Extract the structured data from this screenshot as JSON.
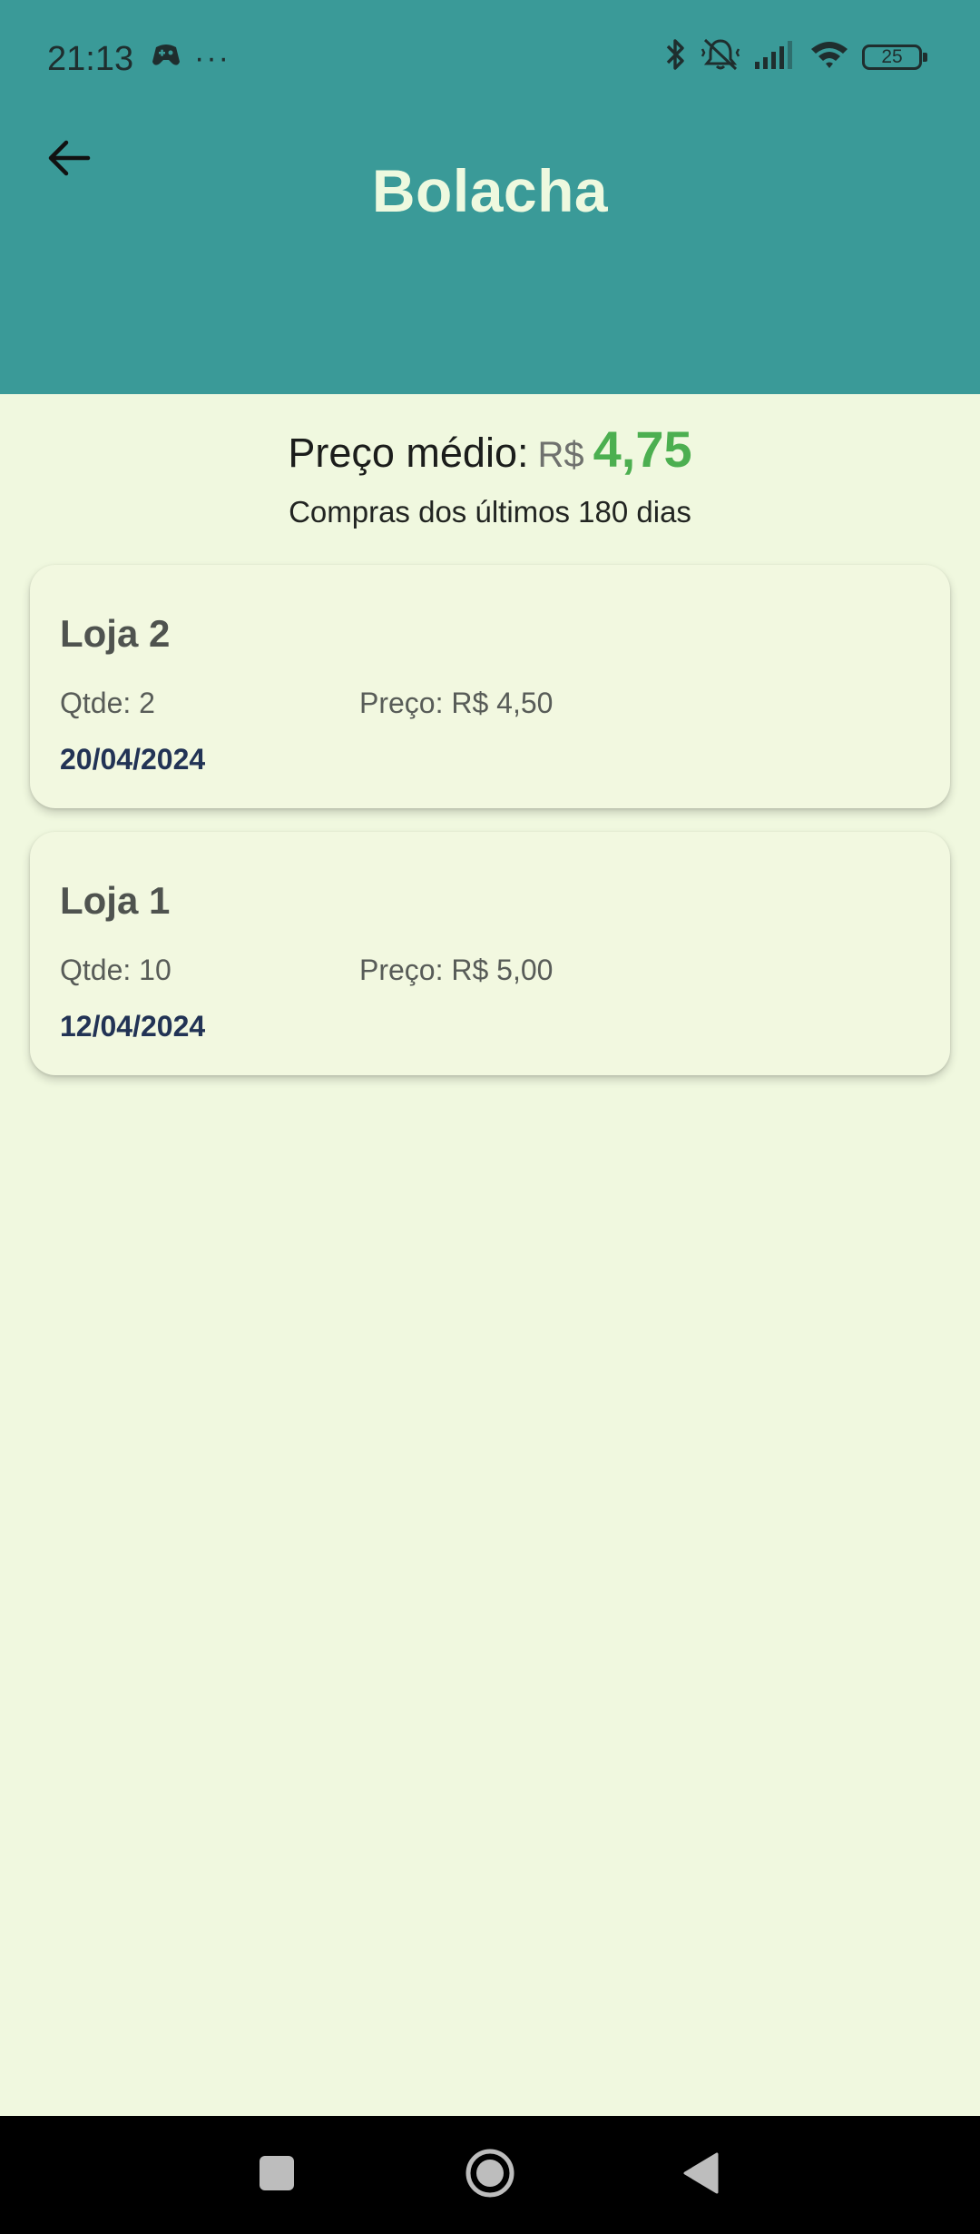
{
  "status_bar": {
    "time": "21:13",
    "more_indicator": "···",
    "battery_level": "25",
    "left_icons": [
      "game-controller-icon",
      "more-dots-icon"
    ],
    "right_icons": [
      "bluetooth-icon",
      "muted-vibrate-icon",
      "cell-signal-icon",
      "wifi-icon",
      "battery-icon"
    ]
  },
  "header": {
    "title": "Bolacha",
    "back_icon": "arrow-left-icon",
    "background_color": "#3a9a98"
  },
  "summary": {
    "avg_label": "Preço médio:",
    "currency": "R$",
    "avg_value": "4,75",
    "period": "Compras dos últimos 180 dias",
    "value_color": "#4caf50"
  },
  "purchases": [
    {
      "store": "Loja 2",
      "qty": "Qtde: 2",
      "price": "Preço: R$ 4,50",
      "date": "20/04/2024"
    },
    {
      "store": "Loja 1",
      "qty": "Qtde: 10",
      "price": "Preço: R$ 5,00",
      "date": "12/04/2024"
    }
  ],
  "navigation": {
    "buttons": [
      "recents-square-icon",
      "home-circle-icon",
      "back-triangle-icon"
    ]
  }
}
